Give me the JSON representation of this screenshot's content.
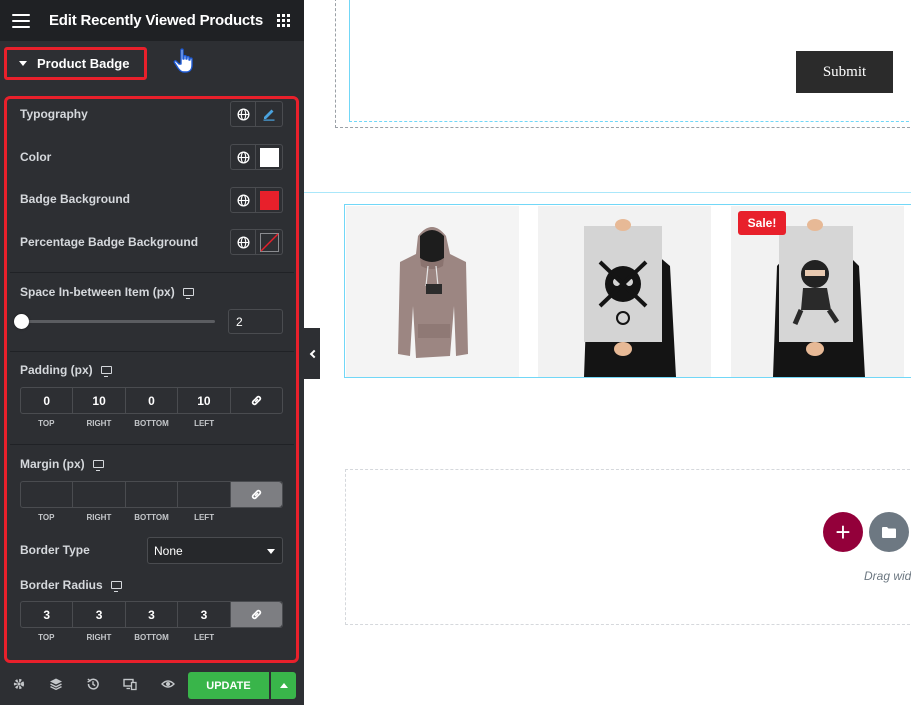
{
  "panel": {
    "title": "Edit Recently Viewed Products",
    "section_title": "Product Badge",
    "typography_label": "Typography",
    "color_label": "Color",
    "color_value": "#ffffff",
    "badge_bg_label": "Badge Background",
    "badge_bg_value": "#e8202b",
    "pct_badge_bg_label": "Percentage Badge Background",
    "space_label": "Space In-between Item (px)",
    "space_value": "2",
    "padding_label": "Padding (px)",
    "padding": {
      "top": "0",
      "right": "10",
      "bottom": "0",
      "left": "10"
    },
    "margin_label": "Margin (px)",
    "margin": {
      "top": "",
      "right": "",
      "bottom": "",
      "left": ""
    },
    "border_type_label": "Border Type",
    "border_type_value": "None",
    "border_radius_label": "Border Radius",
    "border_radius": {
      "top": "3",
      "right": "3",
      "bottom": "3",
      "left": "3"
    },
    "dim_labels": {
      "top": "TOP",
      "right": "RIGHT",
      "bottom": "BOTTOM",
      "left": "LEFT"
    },
    "update_label": "UPDATE",
    "footer_icons": [
      "gear-icon",
      "layers-icon",
      "history-icon",
      "responsive-icon",
      "eye-icon"
    ]
  },
  "canvas": {
    "submit_label": "Submit",
    "sale_label": "Sale!",
    "drag_text": "Drag wid",
    "add_symbol": "+"
  },
  "colors": {
    "accent_red": "#e8202b",
    "update_green": "#39b54a",
    "add_button": "#93003a",
    "folder_button": "#6d7882"
  }
}
